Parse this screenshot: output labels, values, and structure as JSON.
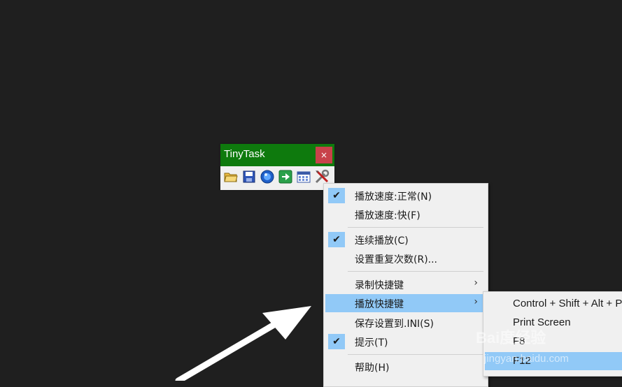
{
  "window": {
    "title": "TinyTask",
    "close_glyph": "×"
  },
  "toolbar": {
    "icons": [
      "open-folder-icon",
      "save-icon",
      "record-icon",
      "play-icon",
      "compile-icon",
      "tools-icon"
    ]
  },
  "menu": {
    "items": [
      {
        "label": "播放速度:正常(N)",
        "checked": true
      },
      {
        "label": "播放速度:快(F)",
        "checked": false
      },
      {
        "label": "连续播放(C)",
        "checked": true
      },
      {
        "label": "设置重复次数(R)...",
        "checked": false
      },
      {
        "label": "录制快捷键",
        "submenu": true
      },
      {
        "label": "播放快捷键",
        "submenu": true,
        "highlighted": true
      },
      {
        "label": "保存设置到.INI(S)",
        "checked": false
      },
      {
        "label": "提示(T)",
        "checked": true
      },
      {
        "label": "帮助(H)",
        "checked": false
      }
    ],
    "arrow_glyph": "›",
    "check_glyph": "✔"
  },
  "submenu": {
    "items": [
      {
        "label": "Control + Shift + Alt + P"
      },
      {
        "label": "Print Screen"
      },
      {
        "label": "F8"
      },
      {
        "label": "F12",
        "highlighted": true
      }
    ]
  },
  "watermark": {
    "brand": "Bai度经验",
    "site": "jingyan.baidu.com"
  },
  "colors": {
    "titlebar": "#0e7a0d",
    "close": "#c8424a",
    "highlight": "#91c9f7",
    "background": "#1f1f1f"
  }
}
